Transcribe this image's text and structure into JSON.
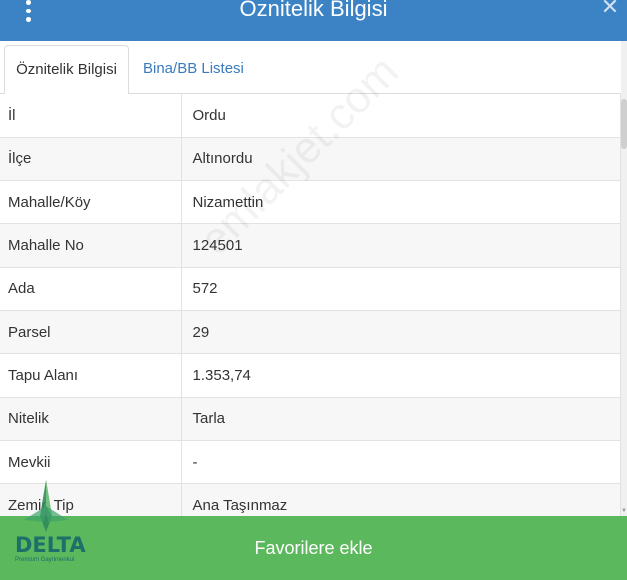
{
  "header": {
    "title": "Öznitelik Bilgisi",
    "close_symbol": "✕"
  },
  "tabs": [
    {
      "label": "Öznitelik Bilgisi",
      "active": true
    },
    {
      "label": "Bina/BB Listesi",
      "active": false
    }
  ],
  "rows": [
    {
      "label": "İl",
      "value": "Ordu"
    },
    {
      "label": "İlçe",
      "value": "Altınordu"
    },
    {
      "label": "Mahalle/Köy",
      "value": "Nizamettin"
    },
    {
      "label": "Mahalle No",
      "value": "124501"
    },
    {
      "label": "Ada",
      "value": "572"
    },
    {
      "label": "Parsel",
      "value": "29"
    },
    {
      "label": "Tapu Alanı",
      "value": "1.353,74"
    },
    {
      "label": "Nitelik",
      "value": "Tarla"
    },
    {
      "label": "Mevkii",
      "value": "-"
    },
    {
      "label": "Zemin Tip",
      "value": "Ana Taşınmaz"
    }
  ],
  "footer": {
    "favorite_button": "Favorilere ekle"
  },
  "logo": {
    "name": "DELTA",
    "tagline": "Premium Gayrimenkul"
  },
  "watermark": "emlakjet.com",
  "colors": {
    "header": "#3b83c5",
    "footer": "#5cb85c",
    "tab_link": "#3a7bbf",
    "logo": "#1d6f6a"
  }
}
